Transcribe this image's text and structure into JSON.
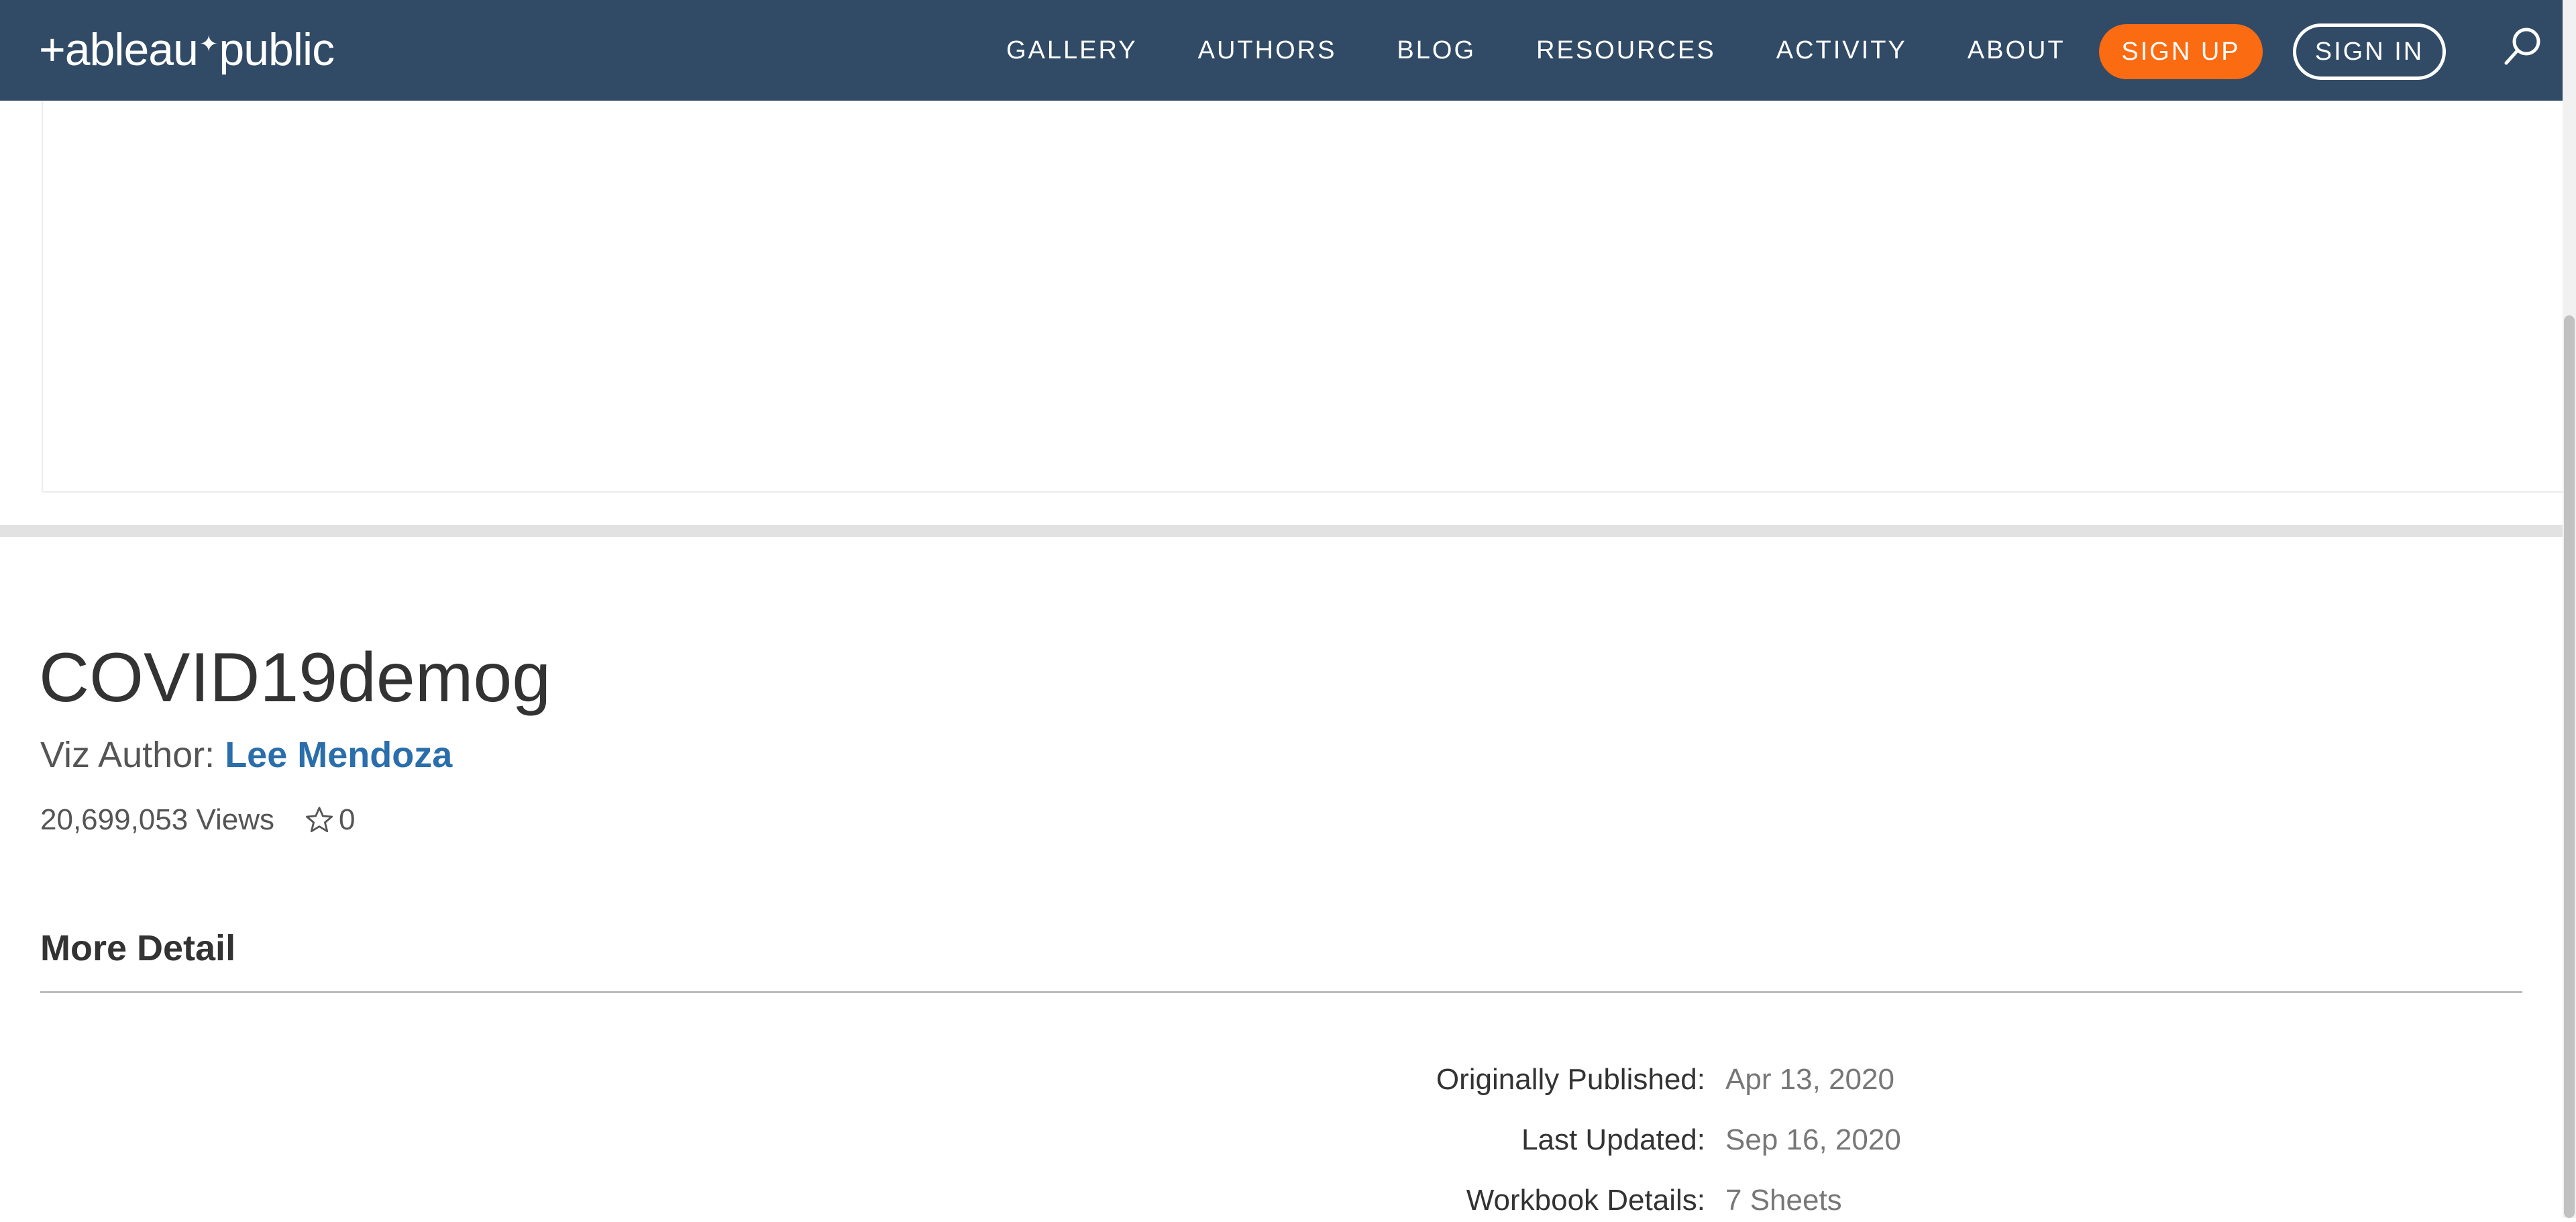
{
  "header": {
    "logo_text": "+ableau+public",
    "nav": {
      "gallery": "GALLERY",
      "authors": "AUTHORS",
      "blog": "BLOG",
      "resources": "RESOURCES",
      "activity": "ACTIVITY",
      "about": "ABOUT"
    },
    "sign_up": "SIGN UP",
    "sign_in": "SIGN IN",
    "search_icon": "search-icon"
  },
  "viz": {
    "title": "COVID19demog",
    "author_prefix": "Viz Author:",
    "author_name": "Lee Mendoza",
    "views": "20,699,053 Views",
    "favorites": "0"
  },
  "more_detail": {
    "heading": "More Detail",
    "rows": [
      {
        "label": "Originally Published:",
        "value": "Apr 13, 2020"
      },
      {
        "label": "Last Updated:",
        "value": "Sep 16, 2020"
      },
      {
        "label": "Workbook Details:",
        "value": "7 Sheets"
      }
    ]
  },
  "colors": {
    "nav_background": "#314b66",
    "sign_up_accent": "#fa6b12",
    "author_link": "#2a6eab"
  }
}
